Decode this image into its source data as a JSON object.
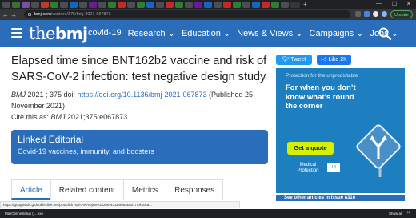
{
  "browser": {
    "url_domain": "bmj.com",
    "url_path": "/content/375/bmj-2021-067873",
    "update_label": "Update",
    "colors": {
      "frame": "#202124",
      "toolbar": "#35363a"
    }
  },
  "header": {
    "logo_prefix": "the",
    "logo_main": "bmj",
    "nav": [
      "covid-19",
      "Research ⌄",
      "Education ⌄",
      "News & Views ⌄",
      "Campaigns ⌄",
      "Jobs ⌄"
    ],
    "brand_color": "#2a6ebb"
  },
  "article": {
    "title": "Elapsed time since BNT162b2 vaccine and risk of SARS-CoV-2 infection: test negative design study",
    "journal": "BMJ",
    "citation_pre": " 2021 ; 375  doi: ",
    "doi": "https://doi.org/10.1136/bmj-2021-067873",
    "published": " (Published 25 November 2021)",
    "cite_label": "Cite this as: ",
    "cite_journal": "BMJ",
    "cite_ref": " 2021;375:e067873"
  },
  "linked_editorial": {
    "title": "Linked Editorial",
    "subtitle": "Covid-19 vaccines, immunity, and boosters"
  },
  "tabs": [
    "Article",
    "Related content",
    "Metrics",
    "Responses"
  ],
  "social": {
    "tweet_label": "Tweet",
    "like_label": "Like 2K"
  },
  "ad": {
    "top_line": "Protection for the unpredictable",
    "headline": "For when you don’t know what’s round the corner",
    "cta": "Get a quote",
    "brand": "Medical Protection",
    "accent": "#d4f200"
  },
  "sidebar_strip": "See other articles in issue 8316",
  "status_url": "https://googleads.g.doubleclick.net/pcs/click?xai=AKAOjsvNoS2h6WJ3Zw9a2BBC7mkxoca...",
  "downloads": {
    "item": "MailOnlineSetup (....exe",
    "show_all": "Show all"
  }
}
